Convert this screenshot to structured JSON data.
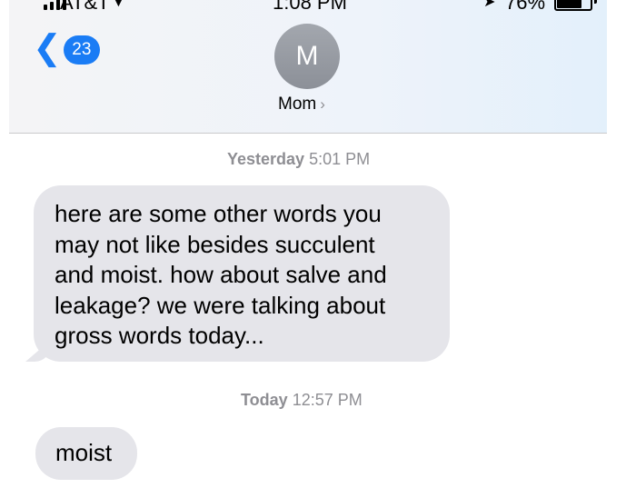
{
  "status_bar": {
    "carrier": "AT&T",
    "time": "1:08 PM",
    "battery_percent": "76%",
    "battery_level": 0.76,
    "signal_bars": 4,
    "icons": [
      "signal-icon",
      "wifi-icon",
      "location-arrow-icon",
      "battery-icon"
    ]
  },
  "header": {
    "back_badge": "23",
    "avatar_initial": "M",
    "contact_name": "Mom",
    "accent_color": "#1a7cf5"
  },
  "conversation": {
    "groups": [
      {
        "day": "Yesterday",
        "time": "5:01 PM",
        "message_lines": [
          "here are some other words you",
          "may not like besides succulent",
          "and moist.  how about salve and",
          "leakage?  we were talking about",
          "gross words today..."
        ]
      },
      {
        "day": "Today",
        "time": "12:57 PM",
        "message": "moist"
      }
    ],
    "bubble_color": "#e5e5ea"
  }
}
